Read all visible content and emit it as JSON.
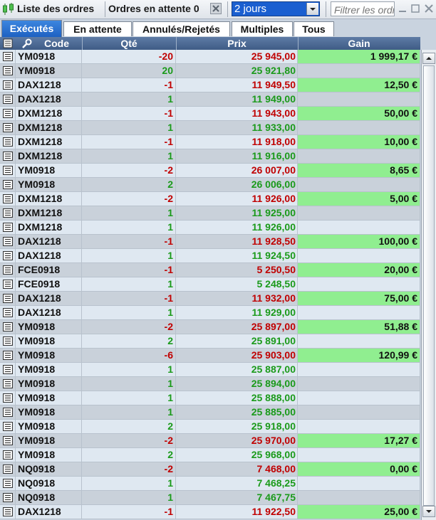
{
  "toolbar": {
    "title": "Liste des ordres",
    "pending_label": "Ordres en attente 0",
    "period_value": "2 jours",
    "filter_placeholder": "Filtrer les ordres"
  },
  "tabs": [
    {
      "label": "Exécutés",
      "active": true
    },
    {
      "label": "En attente"
    },
    {
      "label": "Annulés/Rejetés"
    },
    {
      "label": "Multiples"
    },
    {
      "label": "Tous"
    }
  ],
  "columns": {
    "code": "Code",
    "qty": "Qté",
    "price": "Prix",
    "gain": "Gain"
  },
  "orders": [
    {
      "code": "YM0918",
      "qty": "-20",
      "price": "25 945,00",
      "gain": "1 999,17 €"
    },
    {
      "code": "YM0918",
      "qty": "20",
      "price": "25 921,80",
      "gain": ""
    },
    {
      "code": "DAX1218",
      "qty": "-1",
      "price": "11 949,50",
      "gain": "12,50 €"
    },
    {
      "code": "DAX1218",
      "qty": "1",
      "price": "11 949,00",
      "gain": ""
    },
    {
      "code": "DXM1218",
      "qty": "-1",
      "price": "11 943,00",
      "gain": "50,00 €"
    },
    {
      "code": "DXM1218",
      "qty": "1",
      "price": "11 933,00",
      "gain": ""
    },
    {
      "code": "DXM1218",
      "qty": "-1",
      "price": "11 918,00",
      "gain": "10,00 €"
    },
    {
      "code": "DXM1218",
      "qty": "1",
      "price": "11 916,00",
      "gain": ""
    },
    {
      "code": "YM0918",
      "qty": "-2",
      "price": "26 007,00",
      "gain": "8,65 €"
    },
    {
      "code": "YM0918",
      "qty": "2",
      "price": "26 006,00",
      "gain": ""
    },
    {
      "code": "DXM1218",
      "qty": "-2",
      "price": "11 926,00",
      "gain": "5,00 €"
    },
    {
      "code": "DXM1218",
      "qty": "1",
      "price": "11 925,00",
      "gain": ""
    },
    {
      "code": "DXM1218",
      "qty": "1",
      "price": "11 926,00",
      "gain": ""
    },
    {
      "code": "DAX1218",
      "qty": "-1",
      "price": "11 928,50",
      "gain": "100,00 €"
    },
    {
      "code": "DAX1218",
      "qty": "1",
      "price": "11 924,50",
      "gain": ""
    },
    {
      "code": "FCE0918",
      "qty": "-1",
      "price": "5 250,50",
      "gain": "20,00 €"
    },
    {
      "code": "FCE0918",
      "qty": "1",
      "price": "5 248,50",
      "gain": ""
    },
    {
      "code": "DAX1218",
      "qty": "-1",
      "price": "11 932,00",
      "gain": "75,00 €"
    },
    {
      "code": "DAX1218",
      "qty": "1",
      "price": "11 929,00",
      "gain": ""
    },
    {
      "code": "YM0918",
      "qty": "-2",
      "price": "25 897,00",
      "gain": "51,88 €"
    },
    {
      "code": "YM0918",
      "qty": "2",
      "price": "25 891,00",
      "gain": ""
    },
    {
      "code": "YM0918",
      "qty": "-6",
      "price": "25 903,00",
      "gain": "120,99 €"
    },
    {
      "code": "YM0918",
      "qty": "1",
      "price": "25 887,00",
      "gain": ""
    },
    {
      "code": "YM0918",
      "qty": "1",
      "price": "25 894,00",
      "gain": ""
    },
    {
      "code": "YM0918",
      "qty": "1",
      "price": "25 888,00",
      "gain": ""
    },
    {
      "code": "YM0918",
      "qty": "1",
      "price": "25 885,00",
      "gain": ""
    },
    {
      "code": "YM0918",
      "qty": "2",
      "price": "25 918,00",
      "gain": ""
    },
    {
      "code": "YM0918",
      "qty": "-2",
      "price": "25 970,00",
      "gain": "17,27 €"
    },
    {
      "code": "YM0918",
      "qty": "2",
      "price": "25 968,00",
      "gain": ""
    },
    {
      "code": "NQ0918",
      "qty": "-2",
      "price": "7 468,00",
      "gain": "0,00 €"
    },
    {
      "code": "NQ0918",
      "qty": "1",
      "price": "7 468,25",
      "gain": ""
    },
    {
      "code": "NQ0918",
      "qty": "1",
      "price": "7 467,75",
      "gain": ""
    },
    {
      "code": "DAX1218",
      "qty": "-1",
      "price": "11 922,50",
      "gain": "25,00 €"
    }
  ],
  "colors": {
    "negative": "#c00000",
    "positive": "#1a9a1a",
    "gain_highlight": "#90ee90",
    "active_tab": "#1e61c2"
  }
}
